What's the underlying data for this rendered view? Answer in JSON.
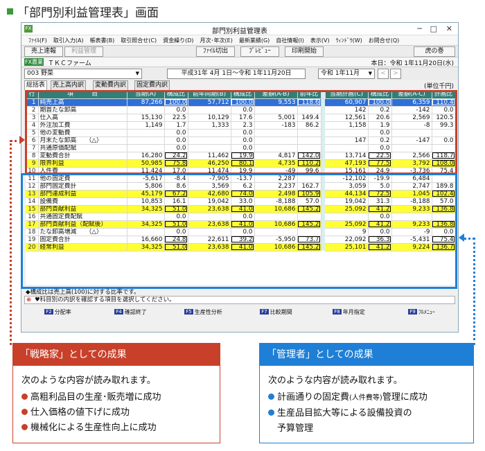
{
  "heading": "「部門別利益管理表」画面",
  "window": {
    "title": "部門別利益管理表",
    "app_icon": "FX",
    "controls": [
      "─",
      "□",
      "✕"
    ]
  },
  "menu": [
    "ﾌｧｲﾙ(F)",
    "取引入力(A)",
    "帳表書(B)",
    "取引照合せ(C)",
    "資金繰り(D)",
    "月次･年次(E)",
    "最新業績(G)",
    "自社情報(I)",
    "表示(V)",
    "ｳｨﾝﾄﾞｳ(W)",
    "お問合せ(Q)"
  ],
  "toolbar": {
    "tab1": "売上速報",
    "tab2": "利益管理",
    "b1": "ﾌｧｲﾙ切出",
    "b2": "ﾌﾟﾚﾋﾞｭｰ",
    "b3": "印刷開始",
    "b4": "虎の巻"
  },
  "company": {
    "badge": "FX農業",
    "name": "ＴＫＣファーム",
    "date": "本日：令和 1年11月20日(水)"
  },
  "filter": {
    "dept": "003 野菜",
    "period": "平成31年 4月 1日〜令和 1年11月20日",
    "month": "令和 1年11月",
    "unit": "(単位千円)"
  },
  "tabs": [
    "総括表",
    "売上高内訳",
    "変動費内訳",
    "固定費内訳"
  ],
  "columns": [
    "行",
    "項　　　目",
    "当期(A)",
    "構成比",
    "前年同期(B)",
    "構成比",
    "差額(A-B)",
    "前年比",
    "",
    "当期計画(C)",
    "構成比",
    "差額(A-C)",
    "計画比"
  ],
  "rows": [
    {
      "no": "1",
      "name": "純売上高",
      "a": "87,266",
      "ap": "100.0",
      "b": "57,712",
      "bp": "100.0",
      "ab": "9,553",
      "r": "118.6",
      "c": "60,907",
      "cp": "100.0",
      "ac": "6,359",
      "cr": "110.4",
      "style": "blue",
      "box": [
        1,
        3,
        5,
        9,
        11
      ]
    },
    {
      "no": "2",
      "name": "期首たな卸高",
      "a": "",
      "ap": "0.0",
      "b": "",
      "bp": "0.0",
      "ab": "",
      "r": "",
      "c": "142",
      "cp": "0.2",
      "ac": "-142",
      "cr": "0.0",
      "style": "",
      "box": []
    },
    {
      "no": "3",
      "name": "仕入高",
      "a": "15,130",
      "ap": "22.5",
      "b": "10,129",
      "bp": "17.6",
      "ab": "5,001",
      "r": "149.4",
      "c": "12,561",
      "cp": "20.6",
      "ac": "2,569",
      "cr": "120.5",
      "style": "",
      "box": []
    },
    {
      "no": "4",
      "name": "外注加工費",
      "a": "1,149",
      "ap": "1.7",
      "b": "1,333",
      "bp": "2.3",
      "ab": "-183",
      "r": "86.2",
      "c": "1,158",
      "cp": "1.9",
      "ac": "-8",
      "cr": "99.3",
      "style": "",
      "box": []
    },
    {
      "no": "5",
      "name": "他の変動費",
      "a": "",
      "ap": "0.0",
      "b": "",
      "bp": "0.0",
      "ab": "",
      "r": "",
      "c": "",
      "cp": "0.0",
      "ac": "",
      "cr": "",
      "style": "",
      "box": []
    },
    {
      "no": "6",
      "name": "月末たな卸高　　（△）",
      "a": "",
      "ap": "0.0",
      "b": "",
      "bp": "0.0",
      "ab": "",
      "r": "",
      "c": "147",
      "cp": "0.2",
      "ac": "-147",
      "cr": "0.0",
      "style": "",
      "box": []
    },
    {
      "no": "7",
      "name": "共通原価配賦",
      "a": "",
      "ap": "0.0",
      "b": "",
      "bp": "0.0",
      "ab": "",
      "r": "",
      "c": "",
      "cp": "0.0",
      "ac": "",
      "cr": "",
      "style": "",
      "box": []
    },
    {
      "no": "8",
      "name": "変動費合計",
      "a": "16,280",
      "ap": "24.2",
      "b": "11,462",
      "bp": "19.9",
      "ab": "4,817",
      "r": "142.0",
      "c": "13,714",
      "cp": "22.5",
      "ac": "2,566",
      "cr": "118.7",
      "style": "",
      "box": [
        1,
        3,
        5,
        9,
        11
      ]
    },
    {
      "no": "9",
      "name": "限界利益",
      "a": "50,985",
      "ap": "75.8",
      "b": "46,250",
      "bp": "80.1",
      "ab": "4,735",
      "r": "110.2",
      "c": "47,193",
      "cp": "77.5",
      "ac": "3,792",
      "cr": "108.0",
      "style": "yel",
      "box": [
        1,
        3,
        5,
        9,
        11
      ]
    },
    {
      "no": "10",
      "name": "人件費",
      "a": "11,424",
      "ap": "17.0",
      "b": "11,474",
      "bp": "19.9",
      "ab": "-49",
      "r": "99.6",
      "c": "15,161",
      "cp": "24.9",
      "ac": "-3,736",
      "cr": "75.4",
      "style": "",
      "box": []
    },
    {
      "no": "11",
      "name": "他の固定費",
      "a": "-5,617",
      "ap": "-8.4",
      "b": "-7,905",
      "bp": "-13.7",
      "ab": "2,287",
      "r": "",
      "c": "-12,102",
      "cp": "-19.9",
      "ac": "6,484",
      "cr": "",
      "style": "",
      "box": []
    },
    {
      "no": "12",
      "name": "部門固定費計",
      "a": "5,806",
      "ap": "8.6",
      "b": "3,569",
      "bp": "6.2",
      "ab": "2,237",
      "r": "162.7",
      "c": "3,059",
      "cp": "5.0",
      "ac": "2,747",
      "cr": "189.8",
      "style": "",
      "box": []
    },
    {
      "no": "13",
      "name": "部門達成利益",
      "a": "45,179",
      "ap": "67.2",
      "b": "42,680",
      "bp": "74.0",
      "ab": "2,498",
      "r": "105.9",
      "c": "44,134",
      "cp": "72.5",
      "ac": "1,045",
      "cr": "102.4",
      "style": "yel",
      "box": [
        1,
        3,
        5,
        9,
        11
      ]
    },
    {
      "no": "14",
      "name": "設備費",
      "a": "10,853",
      "ap": "16.1",
      "b": "19,042",
      "bp": "33.0",
      "ab": "-8,188",
      "r": "57.0",
      "c": "19,042",
      "cp": "31.3",
      "ac": "-8,188",
      "cr": "57.0",
      "style": "",
      "box": []
    },
    {
      "no": "15",
      "name": "部門貢献利益",
      "a": "34,325",
      "ap": "51.0",
      "b": "23,638",
      "bp": "41.0",
      "ab": "10,686",
      "r": "145.2",
      "c": "25,092",
      "cp": "41.2",
      "ac": "9,233",
      "cr": "136.8",
      "style": "yel",
      "box": [
        1,
        3,
        5,
        9,
        11
      ]
    },
    {
      "no": "16",
      "name": "共通固定費配賦",
      "a": "",
      "ap": "0.0",
      "b": "",
      "bp": "0.0",
      "ab": "",
      "r": "",
      "c": "",
      "cp": "0.0",
      "ac": "",
      "cr": "",
      "style": "",
      "box": []
    },
    {
      "no": "17",
      "name": "部門貢献利益（配賦後）",
      "a": "34,325",
      "ap": "51.0",
      "b": "23,638",
      "bp": "41.0",
      "ab": "10,686",
      "r": "145.2",
      "c": "25,092",
      "cp": "41.2",
      "ac": "9,233",
      "cr": "136.8",
      "style": "yel",
      "box": [
        1,
        3,
        5,
        9,
        11
      ]
    },
    {
      "no": "18",
      "name": "たな卸高増減　　（△）",
      "a": "",
      "ap": "0.0",
      "b": "",
      "bp": "0.0",
      "ab": "",
      "r": "",
      "c": "9",
      "cp": "0.0",
      "ac": "-9",
      "cr": "0.0",
      "style": "",
      "box": []
    },
    {
      "no": "19",
      "name": "固定費合計",
      "a": "16,660",
      "ap": "24.8",
      "b": "22,611",
      "bp": "39.2",
      "ab": "-5,950",
      "r": "73.7",
      "c": "22,092",
      "cp": "36.3",
      "ac": "-5,431",
      "cr": "75.4",
      "style": "",
      "box": [
        1,
        3,
        5,
        9,
        11
      ]
    },
    {
      "no": "20",
      "name": "経常利益",
      "a": "34,325",
      "ap": "51.0",
      "b": "23,638",
      "bp": "41.0",
      "ab": "10,686",
      "r": "145.2",
      "c": "25,101",
      "cp": "41.2",
      "ac": "9,224",
      "cr": "136.7",
      "style": "yel",
      "box": [
        1,
        3,
        5,
        9,
        11
      ]
    }
  ],
  "footnote": "◆構成比は売上高(100)に対する比率です。",
  "status": "♥科目別の内訳を確認する項目を選択してください。",
  "fkeys": [
    {
      "k": "F2",
      "l": "分配率"
    },
    {
      "k": "F4",
      "l": "確認終了"
    },
    {
      "k": "F5",
      "l": "生産性分析"
    },
    {
      "k": "F7",
      "l": "比較期間"
    },
    {
      "k": "F8",
      "l": "年月指定"
    },
    {
      "k": "F9",
      "l": "ﾌﾙﾒﾆｭｰ"
    }
  ],
  "cards": [
    {
      "title": "「戦略家」としての成果",
      "lead": "次のような内容が読み取れます。",
      "items": [
        "高粗利品目の生産･販売増に成功",
        "仕入価格の値下げに成功",
        "機械化による生産性向上に成功"
      ]
    },
    {
      "title": "「管理者」としての成果",
      "lead": "次のような内容が読み取れます。",
      "items_a": "計画通りの固定費",
      "items_a_small": "(人件費等)",
      "items_a2": "管理に成功",
      "items_b": "生産品目拡大等による設備投資の",
      "items_b2": "予算管理"
    }
  ],
  "colors": {
    "red": "#c8402a",
    "blue": "#1f7fd6",
    "yellow": "#ffff33",
    "header": "#2f7f7a"
  }
}
